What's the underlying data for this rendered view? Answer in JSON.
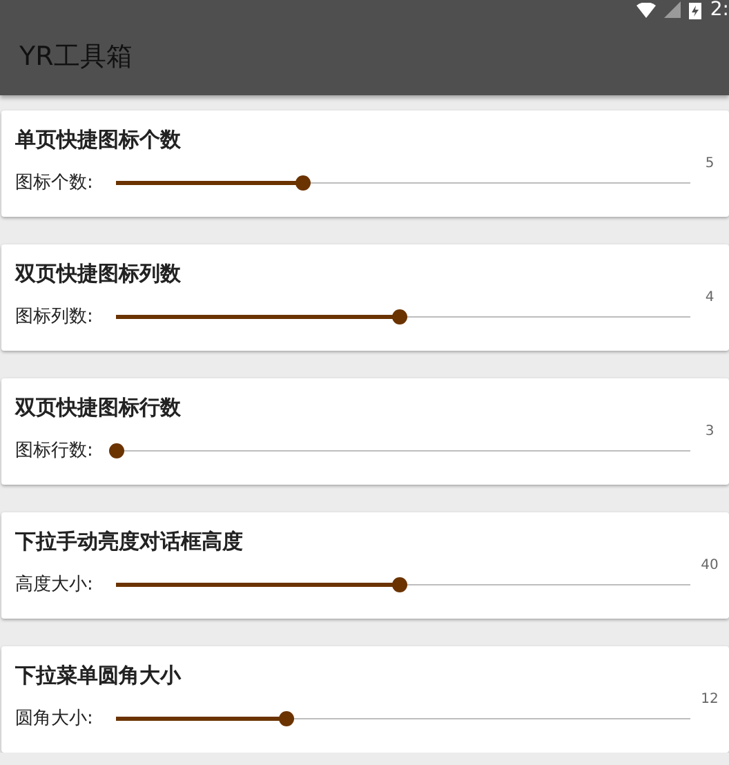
{
  "status_bar": {
    "time": "2:"
  },
  "app_bar": {
    "title": "YR工具箱"
  },
  "settings": [
    {
      "title": "单页快捷图标个数",
      "label": "图标个数:",
      "value": "5",
      "level": 0.33
    },
    {
      "title": "双页快捷图标列数",
      "label": "图标列数:",
      "value": "4",
      "level": 0.5
    },
    {
      "title": "双页快捷图标行数",
      "label": "图标行数:",
      "value": "3",
      "level": 0
    },
    {
      "title": "下拉手动亮度对话框高度",
      "label": "高度大小:",
      "value": "40",
      "level": 0.5
    },
    {
      "title": "下拉菜单圆角大小",
      "label": "圆角大小:",
      "value": "12",
      "level": 0.3
    }
  ]
}
